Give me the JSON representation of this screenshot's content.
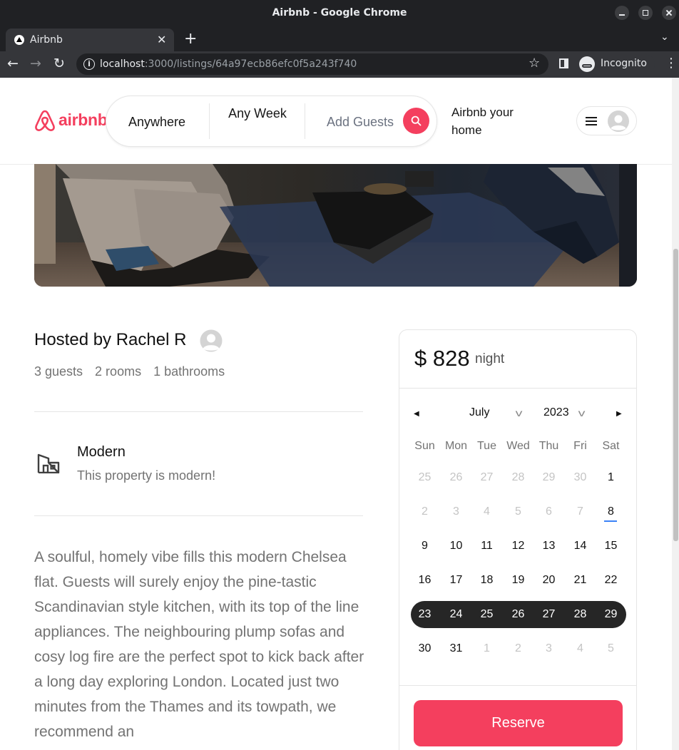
{
  "window": {
    "title": "Airbnb - Google Chrome"
  },
  "tab": {
    "label": "Airbnb"
  },
  "omnibox": {
    "host": "localhost",
    "path": ":3000/listings/64a97ecb86efc0f5a243f740"
  },
  "profile": {
    "label": "Incognito"
  },
  "navbar": {
    "logo_text": "airbnb",
    "search_anywhere": "Anywhere",
    "search_week": "Any Week",
    "search_guests": "Add Guests",
    "host_link": "Airbnb your home"
  },
  "listing": {
    "hosted_by": "Hosted by Rachel R",
    "guests": "3 guests",
    "rooms": "2 rooms",
    "bathrooms": "1 bathrooms",
    "category_label": "Modern",
    "category_desc": "This property is modern!",
    "description": "A soulful, homely vibe fills this modern Chelsea flat. Guests will surely enjoy the pine-tastic Scandinavian style kitchen, with its top of the line appliances. The neighbouring plump sofas and cosy log fire are the perfect spot to kick back after a long day exploring London. Located just two minutes from the Thames and its towpath, we recommend an"
  },
  "reservation": {
    "price": "$ 828",
    "per": "night",
    "month": "July",
    "year": "2023",
    "weekdays": [
      "Sun",
      "Mon",
      "Tue",
      "Wed",
      "Thu",
      "Fri",
      "Sat"
    ],
    "weeks": [
      [
        "25",
        "26",
        "27",
        "28",
        "29",
        "30",
        "1"
      ],
      [
        "2",
        "3",
        "4",
        "5",
        "6",
        "7",
        "8"
      ],
      [
        "9",
        "10",
        "11",
        "12",
        "13",
        "14",
        "15"
      ],
      [
        "16",
        "17",
        "18",
        "19",
        "20",
        "21",
        "22"
      ],
      [
        "23",
        "24",
        "25",
        "26",
        "27",
        "28",
        "29"
      ],
      [
        "30",
        "31",
        "1",
        "2",
        "3",
        "4",
        "5"
      ]
    ],
    "today": "8",
    "selected_range": [
      "23",
      "29"
    ],
    "reserve_label": "Reserve"
  },
  "colors": {
    "brand": "#f43f5e",
    "range": "#262626",
    "today_underline": "#3b82f6"
  },
  "icons": {
    "logo": "airbnb-logo-icon",
    "search": "search-icon",
    "menu": "hamburger-menu-icon",
    "avatar": "user-avatar-icon",
    "category": "modern-building-icon",
    "prev": "chevron-left-icon",
    "next": "chevron-right-icon"
  }
}
